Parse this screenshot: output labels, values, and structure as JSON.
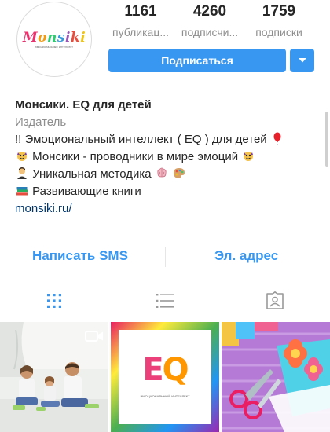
{
  "profile": {
    "avatar_logo_text": "Monsiki",
    "avatar_logo_subtext": "эмоциональный интеллект",
    "stats": [
      {
        "value": "1161",
        "label": "публикац..."
      },
      {
        "value": "4260",
        "label": "подписчи..."
      },
      {
        "value": "1759",
        "label": "подписки"
      }
    ],
    "follow_label": "Подписаться",
    "dropdown_icon": "chevron-down-icon"
  },
  "bio": {
    "name": "Монсики. EQ для детей",
    "category": "Издатель",
    "lines": [
      {
        "text": "!! Эмоциональный интеллект ( EQ ) для детей",
        "emoji_after": [
          "balloon-icon"
        ]
      },
      {
        "text": "Монсики - проводники в мире эмоций",
        "emoji_before": [
          "monster-icon"
        ],
        "emoji_after": [
          "monster-icon"
        ]
      },
      {
        "text": "Уникальная методика",
        "emoji_before": [
          "teacher-icon"
        ],
        "emoji_after": [
          "brain-icon",
          "palette-icon"
        ]
      },
      {
        "text": "Развивающие книги",
        "emoji_before": [
          "books-icon"
        ]
      }
    ],
    "link": "monsiki.ru/"
  },
  "actions": {
    "sms_label": "Написать SMS",
    "email_label": "Эл. адрес"
  },
  "tabs": [
    "grid-icon",
    "list-icon",
    "tagged-icon"
  ],
  "thumbnails": [
    {
      "kind": "video",
      "icon": "video-icon"
    },
    {
      "kind": "image",
      "logo_text": "EQ",
      "caption": "ЭМОЦИОНАЛЬНЫЙ ИНТЕЛЛЕКТ"
    },
    {
      "kind": "image"
    }
  ],
  "colors": {
    "accent": "#3897f0",
    "link": "#003569",
    "muted": "#8e8e8e"
  }
}
